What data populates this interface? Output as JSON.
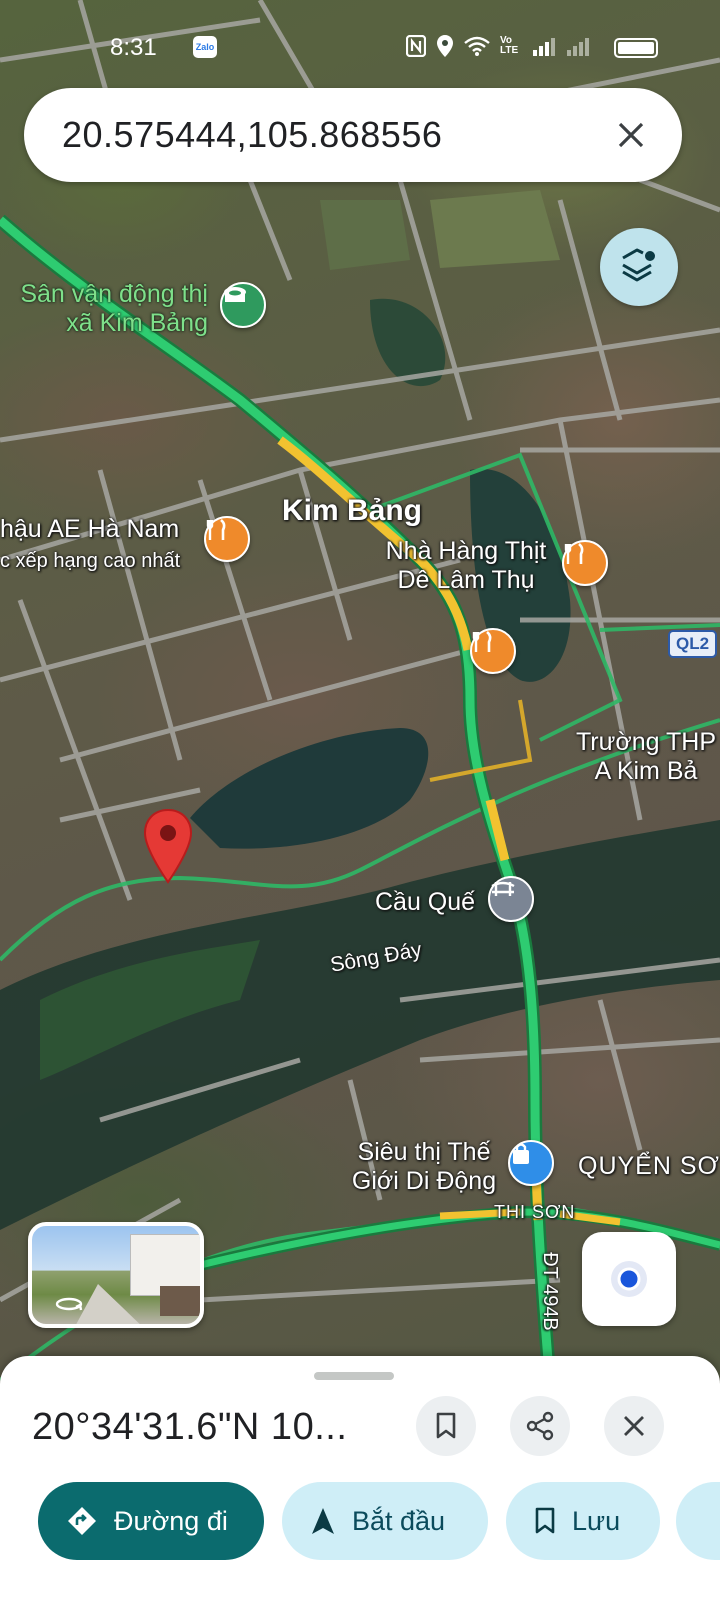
{
  "status_bar": {
    "time": "8:31",
    "zalo": "Zalo",
    "lte": "Vo LTE"
  },
  "search": {
    "query": "20.575444,105.868556"
  },
  "map_labels": {
    "stadium": "Sân vận động thị xã Kim Bảng",
    "town": "Kim Bảng",
    "restaurant_left": "hậu AE Hà Nam",
    "restaurant_left_sub": "c xếp hạng cao nhất",
    "restaurant_right": "Nhà Hàng Thịt Dê Lâm Thụ",
    "school": "Trường THP A Kim Bả",
    "bridge": "Cầu Quế",
    "river": "Sông Đáy",
    "store": "Siêu thị Thế Giới Di Động",
    "district": "QUYỂN SƠ",
    "ward": "THI SƠN",
    "road_dt": "ĐT 494B",
    "road_ql": "QL2"
  },
  "place": {
    "coordinates": "20°34'31.6\"N 10..."
  },
  "actions": {
    "directions": "Đường đi",
    "start": "Bắt đầu",
    "save": "Lưu"
  },
  "colors": {
    "road_traffic": "#2ecc71",
    "road_slow": "#f2c230",
    "pin": "#e53935",
    "primary": "#0b6b6e",
    "tonal": "#cfeef7"
  }
}
